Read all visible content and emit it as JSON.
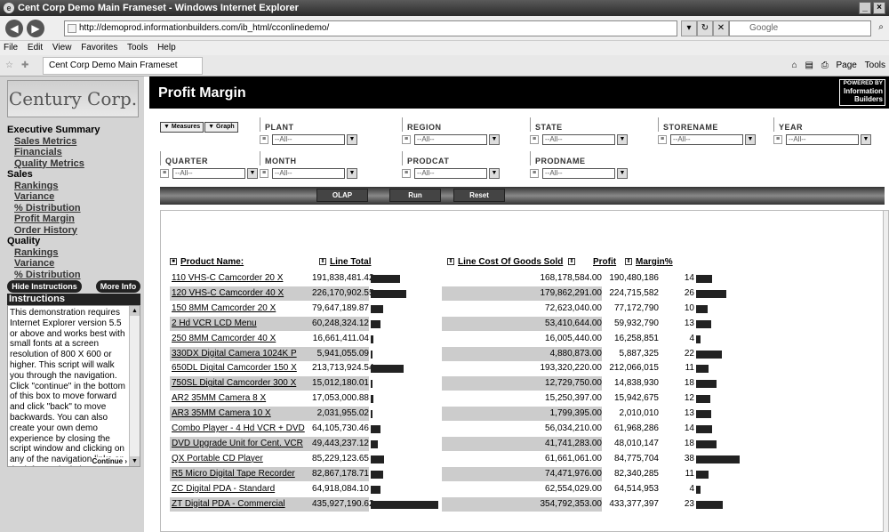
{
  "window": {
    "title": "Cent Corp Demo Main Frameset - Windows Internet Explorer",
    "address": "http://demoprod.informationbuilders.com/ib_html/cconlinedemo/",
    "search_placeholder": "Google",
    "menu": [
      "File",
      "Edit",
      "View",
      "Favorites",
      "Tools",
      "Help"
    ],
    "tab_title": "Cent Corp Demo Main Frameset",
    "toolbar_right": [
      "Page",
      "Tools"
    ]
  },
  "sidebar": {
    "logo_text": "Century Corp.",
    "sections": [
      {
        "category": "Executive Summary",
        "links": [
          "Sales Metrics",
          "Financials",
          "Quality Metrics"
        ]
      },
      {
        "category": "Sales",
        "links": [
          "Rankings",
          "Variance",
          "% Distribution",
          "Profit Margin",
          "Order History"
        ]
      },
      {
        "category": "Quality",
        "links": [
          "Rankings",
          "Variance",
          "% Distribution"
        ]
      }
    ],
    "hide_instructions": "Hide Instructions",
    "more_info": "More Info",
    "instructions_title": "Instructions",
    "instructions_text": "This demonstration requires Internet Explorer version 5.5 or above and works best with small fonts at a screen resolution of 800 X 600 or higher. This script will walk you through the navigation. Click \"continue\" in the bottom of this box to move forward and click \"back\" to move backwards. You can also create your own demo experience by closing the script window and clicking on any of the navigation links on the left to unlock the",
    "continue_label": "Continue ›"
  },
  "header": {
    "title": "Profit Margin",
    "powered_by": [
      "POWERED BY",
      "Information",
      "Builders"
    ]
  },
  "tabs": [
    "Measures",
    "Graph"
  ],
  "filters": [
    {
      "label": "PLANT",
      "value": "--All--"
    },
    {
      "label": "REGION",
      "value": "--All--"
    },
    {
      "label": "STATE",
      "value": "--All--"
    },
    {
      "label": "STORENAME",
      "value": "--All--"
    },
    {
      "label": "YEAR",
      "value": "--All--"
    },
    {
      "label": "QUARTER",
      "value": "--All--"
    },
    {
      "label": "MONTH",
      "value": "--All--"
    },
    {
      "label": "PRODCAT",
      "value": "--All--"
    },
    {
      "label": "PRODNAME",
      "value": "--All--"
    }
  ],
  "actions": [
    "OLAP",
    "Run",
    "Reset"
  ],
  "table": {
    "headers": [
      "Product Name:",
      "Line Total",
      "Line Cost Of Goods Sold",
      "Profit",
      "Margin%"
    ],
    "rows": [
      {
        "name": "110 VHS-C Camcorder 20 X",
        "total": "191,838,481.42",
        "total_level": 0.44,
        "cost": "168,178,584.00",
        "profit": "190,480,186",
        "margin": "14"
      },
      {
        "name": "120 VHS-C Camcorder 40 X",
        "total": "226,170,902.55",
        "total_level": 0.52,
        "cost": "179,862,291.00",
        "profit": "224,715,582",
        "margin": "26"
      },
      {
        "name": "150 8MM Camcorder 20 X",
        "total": "79,647,189.87",
        "total_level": 0.18,
        "cost": "72,623,040.00",
        "profit": "77,172,790",
        "margin": "10"
      },
      {
        "name": "2 Hd VCR LCD Menu",
        "total": "60,248,324.12",
        "total_level": 0.14,
        "cost": "53,410,644.00",
        "profit": "59,932,790",
        "margin": "13"
      },
      {
        "name": "250 8MM Camcorder 40 X",
        "total": "16,661,411.04",
        "total_level": 0.04,
        "cost": "16,005,440.00",
        "profit": "16,258,851",
        "margin": "4"
      },
      {
        "name": "330DX Digital Camera 1024K P",
        "total": "5,941,055.09",
        "total_level": 0.01,
        "cost": "4,880,873.00",
        "profit": "5,887,325",
        "margin": "22"
      },
      {
        "name": "650DL Digital Camcorder 150 X",
        "total": "213,713,924.54",
        "total_level": 0.49,
        "cost": "193,320,220.00",
        "profit": "212,066,015",
        "margin": "11"
      },
      {
        "name": "750SL Digital Camcorder 300 X",
        "total": "15,012,180.01",
        "total_level": 0.03,
        "cost": "12,729,750.00",
        "profit": "14,838,930",
        "margin": "18"
      },
      {
        "name": "AR2 35MM Camera 8 X",
        "total": "17,053,000.88",
        "total_level": 0.04,
        "cost": "15,250,397.00",
        "profit": "15,942,675",
        "margin": "12"
      },
      {
        "name": "AR3 35MM Camera 10 X",
        "total": "2,031,955.02",
        "total_level": 0.0,
        "cost": "1,799,395.00",
        "profit": "2,010,010",
        "margin": "13"
      },
      {
        "name": "Combo Player - 4 Hd VCR + DVD",
        "total": "64,105,730.46",
        "total_level": 0.15,
        "cost": "56,034,210.00",
        "profit": "61,968,286",
        "margin": "14"
      },
      {
        "name": "DVD Upgrade Unit for Cent. VCR",
        "total": "49,443,237.12",
        "total_level": 0.11,
        "cost": "41,741,283.00",
        "profit": "48,010,147",
        "margin": "18"
      },
      {
        "name": "QX Portable CD Player",
        "total": "85,229,123.65",
        "total_level": 0.2,
        "cost": "61,661,061.00",
        "profit": "84,775,704",
        "margin": "38"
      },
      {
        "name": "R5 Micro Digital Tape Recorder",
        "total": "82,867,178.71",
        "total_level": 0.19,
        "cost": "74,471,976.00",
        "profit": "82,340,285",
        "margin": "11"
      },
      {
        "name": "ZC Digital PDA - Standard",
        "total": "64,918,084.10",
        "total_level": 0.15,
        "cost": "62,554,029.00",
        "profit": "64,514,953",
        "margin": "4"
      },
      {
        "name": "ZT Digital PDA - Commercial",
        "total": "435,927,190.62",
        "total_level": 1.0,
        "cost": "354,792,353.00",
        "profit": "433,377,397",
        "margin": "23"
      }
    ]
  }
}
